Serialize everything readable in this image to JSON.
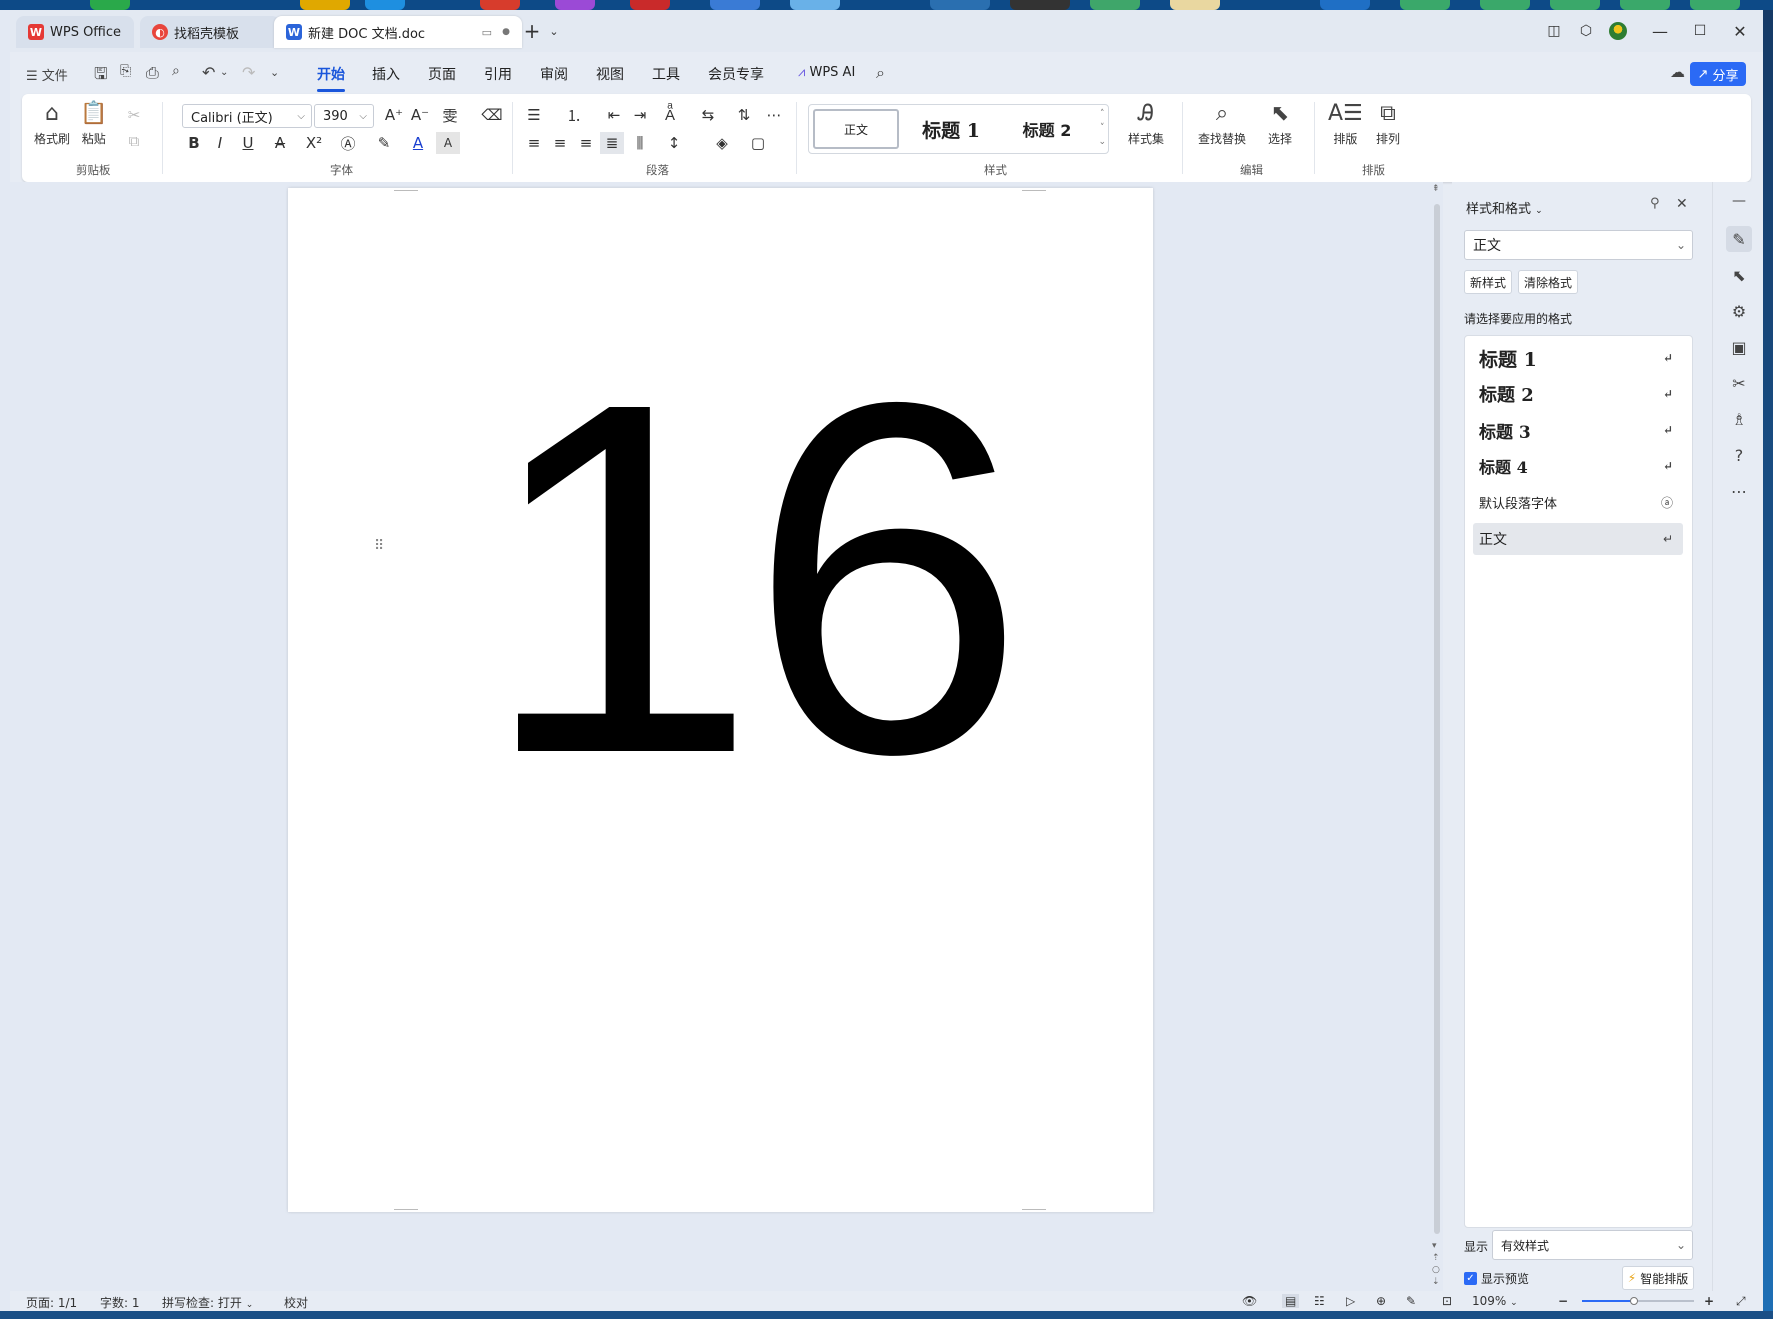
{
  "tabs": [
    {
      "label": "WPS Office"
    },
    {
      "label": "找稻壳模板"
    },
    {
      "label": "新建 DOC 文档.doc"
    }
  ],
  "menu": {
    "file": "文件",
    "items": [
      "开始",
      "插入",
      "页面",
      "引用",
      "审阅",
      "视图",
      "工具",
      "会员专享"
    ],
    "active": "开始",
    "ai": "WPS AI",
    "share": "分享"
  },
  "ribbon": {
    "format_painter": "格式刷",
    "paste": "粘贴",
    "groups": [
      "剪贴板",
      "字体",
      "段落",
      "样式",
      "编辑",
      "排版"
    ],
    "font_name": "Calibri (正文)",
    "font_size": "390",
    "styles": [
      "正文",
      "标题  1",
      "标题  2"
    ],
    "style_set": "样式集",
    "find_replace": "查找替换",
    "select": "选择",
    "layout": "排版",
    "arrange": "排列"
  },
  "document": {
    "text": "16"
  },
  "style_pane": {
    "title": "样式和格式",
    "current": "正文",
    "new_style": "新样式",
    "clear_format": "清除格式",
    "prompt": "请选择要应用的格式",
    "list": [
      "标题  1",
      "标题  2",
      "标题  3",
      "标题  4",
      "默认段落字体",
      "正文"
    ],
    "show_label": "显示",
    "show_value": "有效样式",
    "preview_label": "显示预览",
    "smart_layout": "智能排版"
  },
  "statusbar": {
    "page": "页面: 1/1",
    "words": "字数: 1",
    "spell": "拼写检查: 打开",
    "proof": "校对",
    "zoom": "109%"
  }
}
